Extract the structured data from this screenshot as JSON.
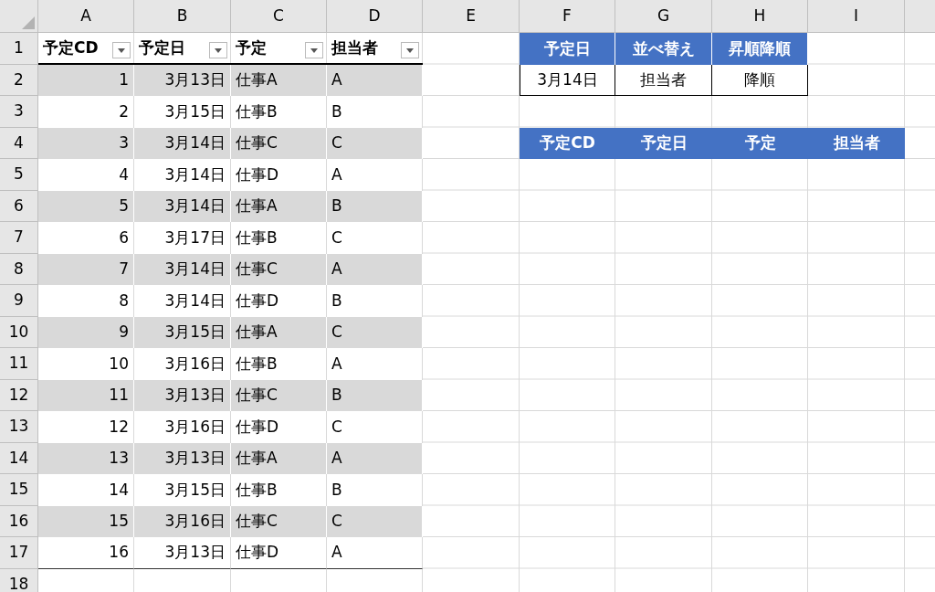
{
  "column_headers": [
    "A",
    "B",
    "C",
    "D",
    "E",
    "F",
    "G",
    "H",
    "I"
  ],
  "row_headers": [
    "1",
    "2",
    "3",
    "4",
    "5",
    "6",
    "7",
    "8",
    "9",
    "10",
    "11",
    "12",
    "13",
    "14",
    "15",
    "16",
    "17",
    "18"
  ],
  "table": {
    "columns": [
      "予定CD",
      "予定日",
      "予定",
      "担当者"
    ],
    "rows": [
      [
        "1",
        "3月13日",
        "仕事A",
        "A"
      ],
      [
        "2",
        "3月15日",
        "仕事B",
        "B"
      ],
      [
        "3",
        "3月14日",
        "仕事C",
        "C"
      ],
      [
        "4",
        "3月14日",
        "仕事D",
        "A"
      ],
      [
        "5",
        "3月14日",
        "仕事A",
        "B"
      ],
      [
        "6",
        "3月17日",
        "仕事B",
        "C"
      ],
      [
        "7",
        "3月14日",
        "仕事C",
        "A"
      ],
      [
        "8",
        "3月14日",
        "仕事D",
        "B"
      ],
      [
        "9",
        "3月15日",
        "仕事A",
        "C"
      ],
      [
        "10",
        "3月16日",
        "仕事B",
        "A"
      ],
      [
        "11",
        "3月13日",
        "仕事C",
        "B"
      ],
      [
        "12",
        "3月16日",
        "仕事D",
        "C"
      ],
      [
        "13",
        "3月13日",
        "仕事A",
        "A"
      ],
      [
        "14",
        "3月15日",
        "仕事B",
        "B"
      ],
      [
        "15",
        "3月16日",
        "仕事C",
        "C"
      ],
      [
        "16",
        "3月13日",
        "仕事D",
        "A"
      ]
    ]
  },
  "criteria": {
    "headers": [
      "予定日",
      "並べ替え",
      "昇順降順"
    ],
    "values": [
      "3月14日",
      "担当者",
      "降順"
    ]
  },
  "result": {
    "headers": [
      "予定CD",
      "予定日",
      "予定",
      "担当者"
    ]
  }
}
